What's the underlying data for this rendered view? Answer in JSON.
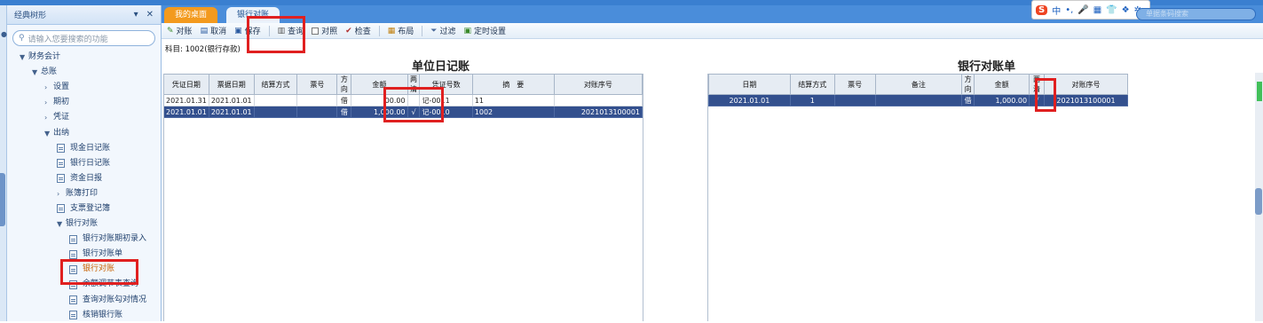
{
  "sidebar": {
    "title": "经典树形",
    "pin_icon": "pin-icon",
    "close_icon": "close-icon",
    "search_placeholder": "请输入您要搜索的功能",
    "tree": [
      {
        "label": "财务会计",
        "level": 0,
        "arrow": "▼"
      },
      {
        "label": "总账",
        "level": 1,
        "arrow": "▼"
      },
      {
        "label": "设置",
        "level": 2,
        "arrow": "›"
      },
      {
        "label": "期初",
        "level": 2,
        "arrow": "›"
      },
      {
        "label": "凭证",
        "level": 2,
        "arrow": "›"
      },
      {
        "label": "出纳",
        "level": 2,
        "arrow": "▼"
      },
      {
        "label": "现金日记账",
        "level": 3,
        "doc": true
      },
      {
        "label": "银行日记账",
        "level": 3,
        "doc": true
      },
      {
        "label": "资金日报",
        "level": 3,
        "doc": true
      },
      {
        "label": "账簿打印",
        "level": 3,
        "arrow": "›"
      },
      {
        "label": "支票登记簿",
        "level": 3,
        "doc": true
      },
      {
        "label": "银行对账",
        "level": 3,
        "arrow": "▼"
      },
      {
        "label": "银行对账期初录入",
        "level": 4,
        "doc": true
      },
      {
        "label": "银行对账单",
        "level": 4,
        "doc": true
      },
      {
        "label": "银行对账",
        "level": 4,
        "doc": true,
        "selected": true
      },
      {
        "label": "余额调节表查询",
        "level": 4,
        "doc": true
      },
      {
        "label": "查询对账勾对情况",
        "level": 4,
        "doc": true
      },
      {
        "label": "核销银行账",
        "level": 4,
        "doc": true
      }
    ]
  },
  "tabs": [
    {
      "label": "我的桌面",
      "active": false
    },
    {
      "label": "银行对账",
      "active": true
    }
  ],
  "ime": {
    "logo": "S",
    "items": [
      "中",
      "•,",
      "🎤",
      "▦",
      "👕",
      "❖",
      "✲"
    ]
  },
  "top_search_placeholder": "单据条码搜索",
  "toolbar": {
    "reconcile": "对账",
    "cancel": "取消",
    "save": "保存",
    "query": "查询",
    "compare": "对照",
    "check": "检查",
    "layout": "布局",
    "filter": "过滤",
    "schedule": "定时设置"
  },
  "subject": "科目: 1002(银行存款)",
  "left_table": {
    "title": "单位日记账",
    "columns": [
      "凭证日期",
      "票据日期",
      "结算方式",
      "票号",
      "方向",
      "金额",
      "两清",
      "凭证号数",
      "摘　要",
      "对账序号"
    ],
    "rows": [
      {
        "voucher_date": "2021.01.31",
        "bill_date": "2021.01.01",
        "settle": "",
        "ticket": "",
        "dir": "借",
        "amount": "00.00",
        "cleared": "",
        "voucher_no": "记-0011",
        "summary": "11",
        "seq": "",
        "highlight": false
      },
      {
        "voucher_date": "2021.01.01",
        "bill_date": "2021.01.01",
        "settle": "",
        "ticket": "",
        "dir": "借",
        "amount": "1,000.00",
        "cleared": "√",
        "voucher_no": "记-0010",
        "summary": "1002",
        "seq": "2021013100001",
        "highlight": true
      }
    ]
  },
  "right_table": {
    "title": "银行对账单",
    "columns": [
      "日期",
      "结算方式",
      "票号",
      "备注",
      "方向",
      "金额",
      "两清",
      "对账序号"
    ],
    "rows": [
      {
        "date": "2021.01.01",
        "settle": "1",
        "ticket": "",
        "note": "",
        "dir": "借",
        "amount": "1,000.00",
        "cleared": "√",
        "seq": "2021013100001",
        "highlight": true
      }
    ]
  }
}
